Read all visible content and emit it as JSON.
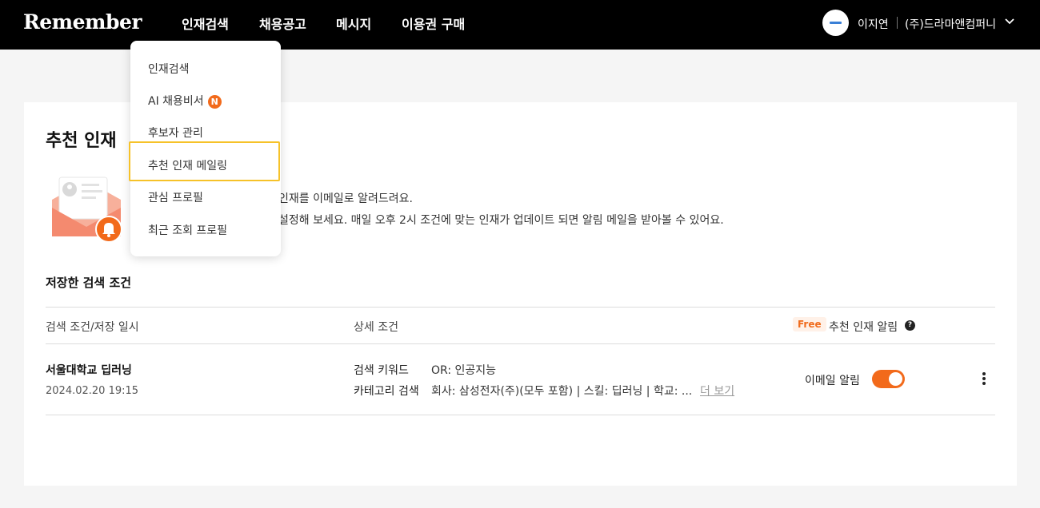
{
  "header": {
    "logo": "Remember",
    "nav": [
      "인재검색",
      "채용공고",
      "메시지",
      "이용권 구매"
    ],
    "user_name": "이지연",
    "company": "(주)드라마앤컴퍼니"
  },
  "dropdown": {
    "items": [
      {
        "label": "인재검색",
        "badge": ""
      },
      {
        "label": "AI 채용비서",
        "badge": "N"
      },
      {
        "label": "후보자 관리",
        "badge": ""
      },
      {
        "label": "추천 인재 메일링",
        "badge": ""
      },
      {
        "label": "관심 프로필",
        "badge": ""
      },
      {
        "label": "최근 조회 프로필",
        "badge": ""
      }
    ],
    "highlighted_item": "추천 인재 메일링"
  },
  "main": {
    "title": "추천 인재",
    "desc_line1": "인재를 이메일로 알려드려요.",
    "desc_line2": "설정해 보세요. 매일 오후 2시 조건에 맞는 인재가 업데이트 되면 알림 메일을 받아볼 수 있어요.",
    "section_title": "저장한 검색 조건",
    "table": {
      "headers": {
        "col1": "검색 조건/저장 일시",
        "col2": "상세 조건",
        "free_badge": "Free",
        "col3": "추천 인재 알림"
      },
      "rows": [
        {
          "title": "서울대학교 딥러닝",
          "date": "2024.02.20 19:15",
          "keyword_label": "검색 키워드",
          "keyword_value": "OR: 인공지능",
          "category_label": "카테고리 검색",
          "category_value": "회사: 삼성전자(주)(모두 포함) | 스킬: 딥러닝 | 학교: ...",
          "more_label": "더 보기",
          "alert_label": "이메일 알림",
          "alert_on": true
        }
      ]
    }
  },
  "colors": {
    "accent": "#f26a1b",
    "highlight": "#f6c229",
    "header_bg": "#000000"
  },
  "icons": [
    "chevron-down-icon",
    "help-icon",
    "kebab-menu-icon",
    "mail-illustration-icon",
    "bell-icon"
  ]
}
